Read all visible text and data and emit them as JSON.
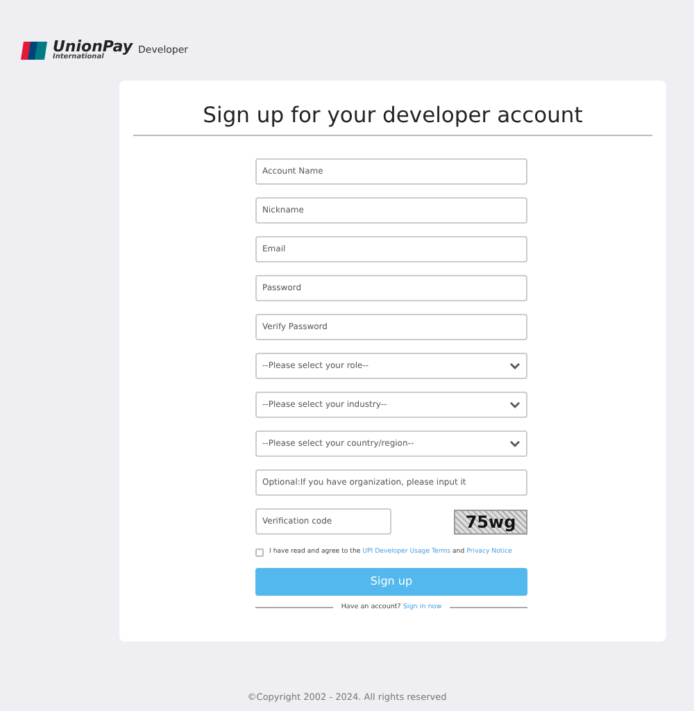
{
  "header": {
    "brand": "UnionPay",
    "brand_sub": "International",
    "product": "Developer"
  },
  "form": {
    "title": "Sign up for your developer account",
    "fields": [
      {
        "kind": "input",
        "placeholder": "Account Name"
      },
      {
        "kind": "input",
        "placeholder": "Nickname"
      },
      {
        "kind": "input",
        "placeholder": "Email"
      },
      {
        "kind": "input",
        "placeholder": "Password"
      },
      {
        "kind": "input",
        "placeholder": "Verify Password"
      },
      {
        "kind": "select",
        "placeholder": "--Please select your role--"
      },
      {
        "kind": "select",
        "placeholder": "--Please select your industry--"
      },
      {
        "kind": "select",
        "placeholder": "--Please select your country/region--"
      },
      {
        "kind": "input",
        "placeholder": "Optional:If you have organization, please input it"
      }
    ],
    "verification": {
      "placeholder": "Verification code",
      "captcha": "75wg"
    },
    "agreement": {
      "checked": false,
      "text_before": "I have read and agree to the",
      "link_terms": "UPI Developer Usage Terms",
      "text_between": "and",
      "link_privacy": "Privacy Notice"
    },
    "submit": "Sign up",
    "signin": {
      "text": "Have an account?",
      "link": "Sign in now"
    }
  },
  "footer": "©Copyright 2002 - 2024. All rights reserved"
}
